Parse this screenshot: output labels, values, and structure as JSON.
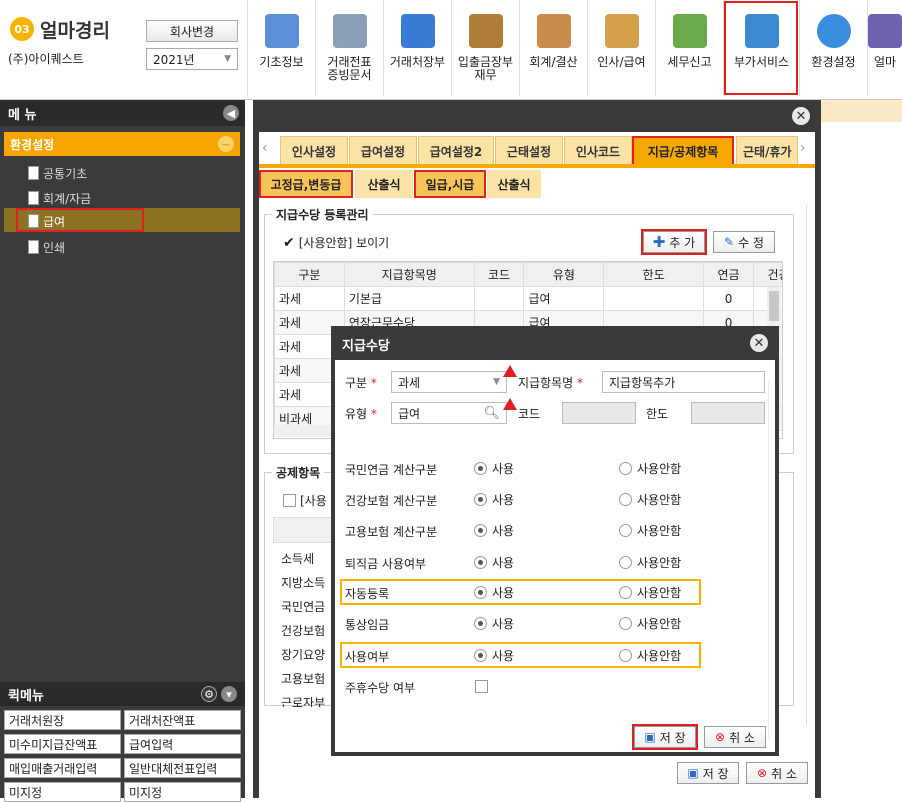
{
  "app": {
    "logo_mark": "03",
    "logo_text": "얼마경리",
    "company": "(주)아이퀘스트",
    "change_company": "회사변경",
    "year": "2021년"
  },
  "top_menu": [
    {
      "label": "기초정보",
      "color": "#5b8fd6"
    },
    {
      "label": "거래전표\n증빙문서",
      "color": "#8aa0b8"
    },
    {
      "label": "거래처장부",
      "color": "#3a7bd5"
    },
    {
      "label": "입출금장부\n재무",
      "color": "#b07d3a"
    },
    {
      "label": "회계/결산",
      "color": "#c98a4b"
    },
    {
      "label": "인사/급여",
      "color": "#d4a14a"
    },
    {
      "label": "세무신고",
      "color": "#6aaa4c"
    },
    {
      "label": "부가서비스",
      "color": "#3c8ad1"
    },
    {
      "label": "환경설정",
      "color": "#3a8ee0"
    },
    {
      "label": "얼마",
      "color": "#7060b0"
    }
  ],
  "sidebar": {
    "title": "메 뉴",
    "section": "환경설정",
    "items": [
      {
        "label": "공통기초"
      },
      {
        "label": "회계/자금"
      },
      {
        "label": "급여"
      },
      {
        "label": "인쇄"
      }
    ]
  },
  "quick": {
    "title": "퀵메뉴",
    "items": [
      "거래처원장",
      "거래처잔액표",
      "미수미지급잔액표",
      "급여입력",
      "매입매출거래입력",
      "일반대체전표입력",
      "미지정",
      "미지정"
    ]
  },
  "modal": {
    "tabs": [
      "인사설정",
      "급여설정",
      "급여설정2",
      "근태설정",
      "인사코드",
      "지급/공제항목",
      "근태/휴가"
    ],
    "subtabs": [
      "고정급,변동급",
      "산출식",
      "일급,시급",
      "산출식"
    ],
    "group1_title": "지급수당 등록관리",
    "show_unused": "[사용안함] 보이기",
    "add_btn": "추 가",
    "edit_btn": "수 정",
    "columns": [
      "구분",
      "지급항목명",
      "코드",
      "유형",
      "한도",
      "연금",
      "건강"
    ],
    "rows": [
      {
        "type": "과세",
        "name": "기본급",
        "code": "",
        "kind": "급여",
        "limit": "",
        "pension": "0",
        "health": ""
      },
      {
        "type": "과세",
        "name": "연장근무수당",
        "code": "",
        "kind": "급여",
        "limit": "",
        "pension": "0",
        "health": ""
      },
      {
        "type": "과세",
        "name": "",
        "code": "",
        "kind": "",
        "limit": "",
        "pension": "",
        "health": ""
      },
      {
        "type": "과세",
        "name": "",
        "code": "",
        "kind": "",
        "limit": "",
        "pension": "",
        "health": ""
      },
      {
        "type": "과세",
        "name": "",
        "code": "",
        "kind": "",
        "limit": "",
        "pension": "",
        "health": ""
      },
      {
        "type": "비과세",
        "name": "",
        "code": "",
        "kind": "",
        "limit": "",
        "pension": "",
        "health": ""
      }
    ],
    "group2_title": "공제항목",
    "show_unused2": "[사용",
    "ded_rows": [
      "소득세",
      "지방소득",
      "국민연금",
      "건강보험",
      "장기요양",
      "고용보험",
      "근로자부"
    ],
    "save": "저 장",
    "cancel": "취 소"
  },
  "dialog": {
    "title": "지급수당",
    "f_type_label": "구분",
    "f_type_value": "과세",
    "f_name_label": "지급항목명",
    "f_name_value": "지급항목추가",
    "f_kind_label": "유형",
    "f_kind_value": "급여",
    "f_code_label": "코드",
    "f_limit_label": "한도",
    "on_label": "사용",
    "off_label": "사용안함",
    "options": [
      {
        "label": "국민연금 계산구분",
        "value": "사용"
      },
      {
        "label": "건강보험 계산구분",
        "value": "사용"
      },
      {
        "label": "고용보험 계산구분",
        "value": "사용"
      },
      {
        "label": "퇴직금 사용여부",
        "value": "사용"
      },
      {
        "label": "자동등록",
        "value": "사용"
      },
      {
        "label": "통상임금",
        "value": "사용"
      },
      {
        "label": "사용여부",
        "value": "사용"
      }
    ],
    "weekly_label": "주휴수당 여부",
    "save": "저 장",
    "cancel": "취 소"
  }
}
